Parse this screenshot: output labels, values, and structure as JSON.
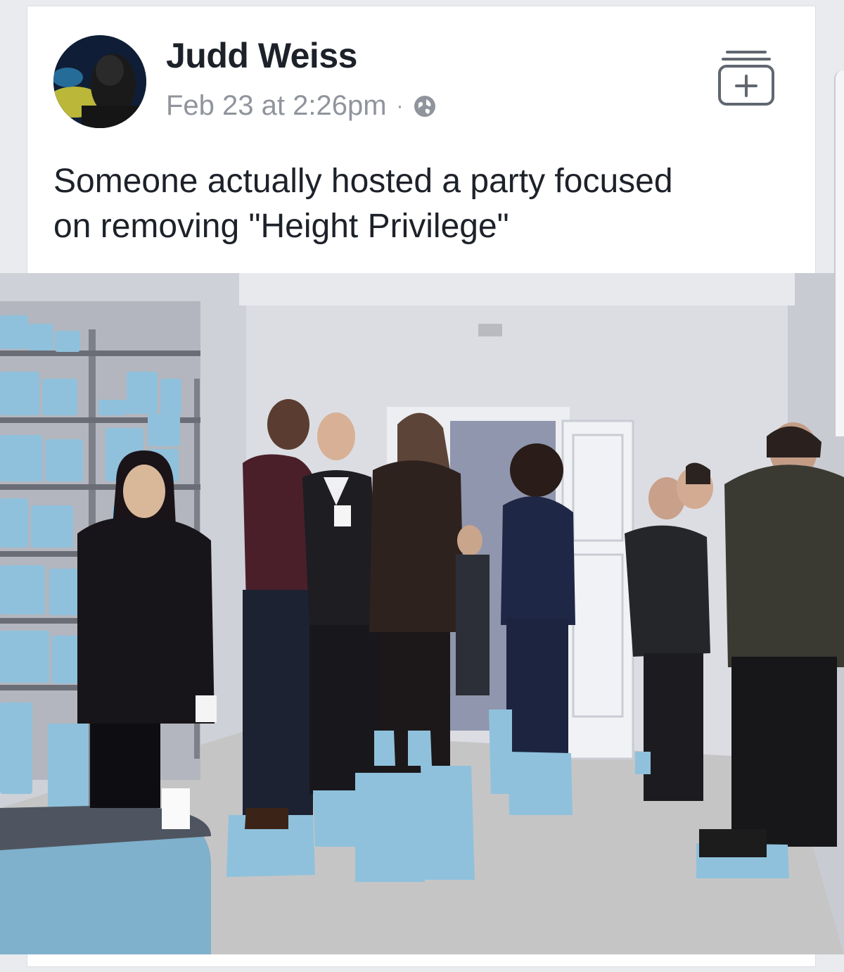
{
  "post": {
    "author": "Judd Weiss",
    "timestamp": "Feb 23 at 2:26pm",
    "separator": "·",
    "privacy_icon": "globe-icon",
    "save_icon": "save-plus-icon",
    "text": "Someone actually hosted a party focused\non removing \"Height Privilege\""
  },
  "colors": {
    "author": "#1d2129",
    "meta": "#90949c",
    "stilt_blue": "#8fc1dc",
    "card_bg": "#ffffff",
    "page_bg": "#e9ebee"
  }
}
